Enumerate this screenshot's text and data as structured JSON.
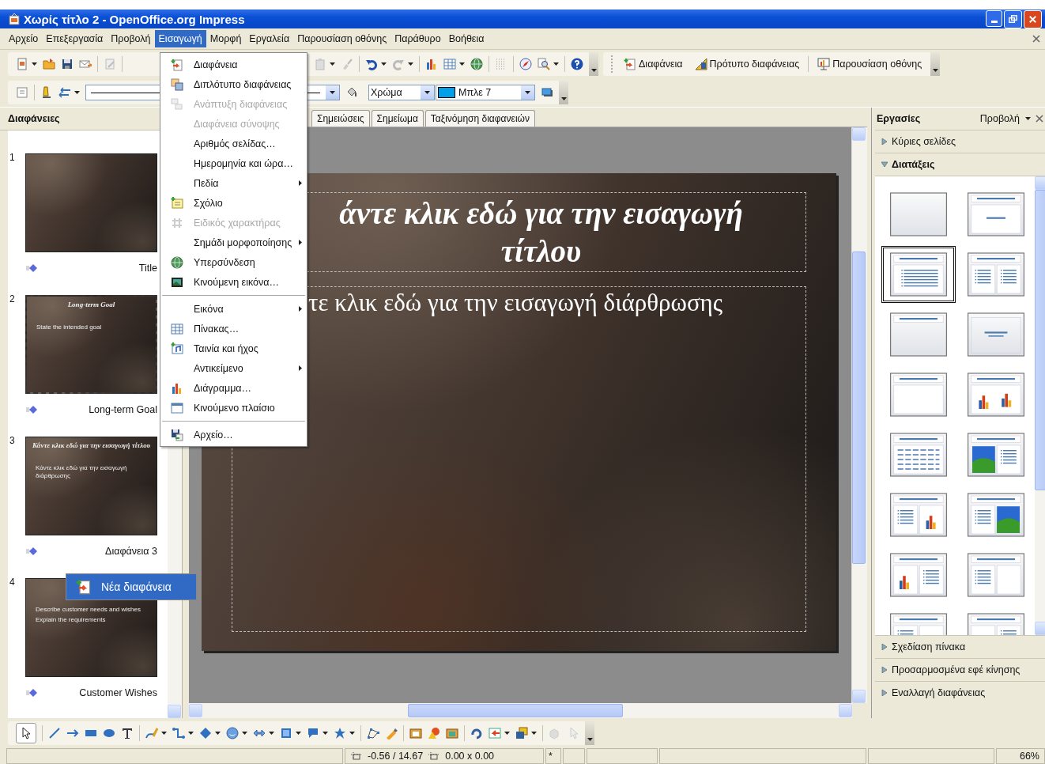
{
  "window": {
    "title": "Χωρίς τίτλο 2 - OpenOffice.org Impress"
  },
  "menu_bar": [
    {
      "label": "Αρχείο",
      "selected": false
    },
    {
      "label": "Επεξεργασία",
      "selected": false
    },
    {
      "label": "Προβολή",
      "selected": false
    },
    {
      "label": "Εισαγωγή",
      "selected": true
    },
    {
      "label": "Μορφή",
      "selected": false
    },
    {
      "label": "Εργαλεία",
      "selected": false
    },
    {
      "label": "Παρουσίαση οθόνης",
      "selected": false
    },
    {
      "label": "Παράθυρο",
      "selected": false
    },
    {
      "label": "Βοήθεια",
      "selected": false
    }
  ],
  "insert_menu": [
    {
      "kind": "item",
      "label": "Διαφάνεια",
      "disabled": false,
      "submenu": false
    },
    {
      "kind": "item",
      "label": "Διπλότυπο διαφάνειας",
      "disabled": false,
      "submenu": false
    },
    {
      "kind": "item",
      "label": "Ανάπτυξη διαφάνειας",
      "disabled": true,
      "submenu": false
    },
    {
      "kind": "item",
      "label": "Διαφάνεια σύνοψης",
      "disabled": true,
      "submenu": false
    },
    {
      "kind": "item",
      "label": "Αριθμός σελίδας…",
      "disabled": false,
      "submenu": false
    },
    {
      "kind": "item",
      "label": "Ημερομηνία και ώρα…",
      "disabled": false,
      "submenu": false
    },
    {
      "kind": "item",
      "label": "Πεδία",
      "disabled": false,
      "submenu": true
    },
    {
      "kind": "item",
      "label": "Σχόλιο",
      "disabled": false,
      "submenu": false
    },
    {
      "kind": "item",
      "label": "Ειδικός χαρακτήρας",
      "disabled": true,
      "submenu": false
    },
    {
      "kind": "item",
      "label": "Σημάδι μορφοποίησης",
      "disabled": false,
      "submenu": true
    },
    {
      "kind": "item",
      "label": "Υπερσύνδεση",
      "disabled": false,
      "submenu": false
    },
    {
      "kind": "item",
      "label": "Κινούμενη εικόνα…",
      "disabled": false,
      "submenu": false
    },
    {
      "kind": "separator"
    },
    {
      "kind": "item",
      "label": "Εικόνα",
      "disabled": false,
      "submenu": true
    },
    {
      "kind": "item",
      "label": "Πίνακας…",
      "disabled": false,
      "submenu": false
    },
    {
      "kind": "item",
      "label": "Ταινία και ήχος",
      "disabled": false,
      "submenu": false
    },
    {
      "kind": "item",
      "label": "Αντικείμενο",
      "disabled": false,
      "submenu": true
    },
    {
      "kind": "item",
      "label": "Διάγραμμα…",
      "disabled": false,
      "submenu": false
    },
    {
      "kind": "item",
      "label": "Κινούμενο πλαίσιο",
      "disabled": false,
      "submenu": false
    },
    {
      "kind": "separator"
    },
    {
      "kind": "item",
      "label": "Αρχείο…",
      "disabled": false,
      "submenu": false
    }
  ],
  "toolbar": {
    "buttons": [
      "Διαφάνεια",
      "Πρότυπο διαφάνειας",
      "Παρουσίαση οθόνης"
    ]
  },
  "format_toolbar": {
    "area_style": "Χρώμα",
    "fill_color": {
      "label": "Μπλε 7",
      "color": "#00a0e8"
    }
  },
  "slides_panel": {
    "title": "Διαφάνειες",
    "slides": [
      {
        "number": "1",
        "name": "Title",
        "selected": false
      },
      {
        "number": "2",
        "name": "Long-term Goal",
        "selected": true,
        "title": "Long-term Goal",
        "bullets": [
          "State the intended goal"
        ]
      },
      {
        "number": "3",
        "name": "Διαφάνεια 3",
        "selected": false,
        "title": "Κάντε κλικ εδώ για την εισαγωγή τίτλου",
        "bullets": [
          "Κάντε κλικ εδώ για την εισαγωγή διάρθρωσης"
        ]
      },
      {
        "number": "4",
        "name": "Customer Wishes",
        "selected": false,
        "bullets": [
          "Describe customer needs and wishes",
          "Explain the requirements"
        ]
      }
    ],
    "context_menu": {
      "label": "Νέα διαφάνεια",
      "selected": true
    }
  },
  "view_tabs": [
    {
      "label": "Σημειώσεις",
      "selected": false
    },
    {
      "label": "Σημείωμα",
      "selected": false
    },
    {
      "label": "Ταξινόμηση διαφανειών",
      "selected": false
    }
  ],
  "slide": {
    "title": "άντε κλικ εδώ για την εισαγωγή τίτλου",
    "outline": "τε κλικ εδώ για την εισαγωγή διάρθρωσης"
  },
  "task_pane": {
    "title": "Εργασίες",
    "view_menu": "Προβολή",
    "sections_top": [
      {
        "label": "Κύριες σελίδες",
        "expanded": false
      },
      {
        "label": "Διατάξεις",
        "expanded": true
      }
    ],
    "layouts": [
      {
        "kind": "blank",
        "selected": false
      },
      {
        "kind": "title-only",
        "selected": false
      },
      {
        "kind": "title-content",
        "selected": true
      },
      {
        "kind": "title-two-content",
        "selected": false
      },
      {
        "kind": "title-bar",
        "selected": false
      },
      {
        "kind": "centered",
        "selected": false
      },
      {
        "kind": "title-box",
        "selected": false
      },
      {
        "kind": "title-chart",
        "selected": false
      },
      {
        "kind": "title-table",
        "selected": false
      },
      {
        "kind": "picture-content",
        "selected": false
      },
      {
        "kind": "content-chart",
        "selected": false
      },
      {
        "kind": "content-picture",
        "selected": false
      },
      {
        "kind": "chart-content",
        "selected": false
      },
      {
        "kind": "content-box",
        "selected": false
      },
      {
        "kind": "content-split",
        "selected": false
      },
      {
        "kind": "box-content",
        "selected": false
      }
    ],
    "sections_bottom": [
      {
        "label": "Σχεδίαση πίνακα",
        "expanded": false
      },
      {
        "label": "Προσαρμοσμένα εφέ κίνησης",
        "expanded": false
      },
      {
        "label": "Εναλλαγή διαφάνειας",
        "expanded": false
      }
    ]
  },
  "status_bar": {
    "position": "-0.56 / 14.67",
    "size": "0.00 x 0.00",
    "modified": "*",
    "zoom": "66%"
  }
}
